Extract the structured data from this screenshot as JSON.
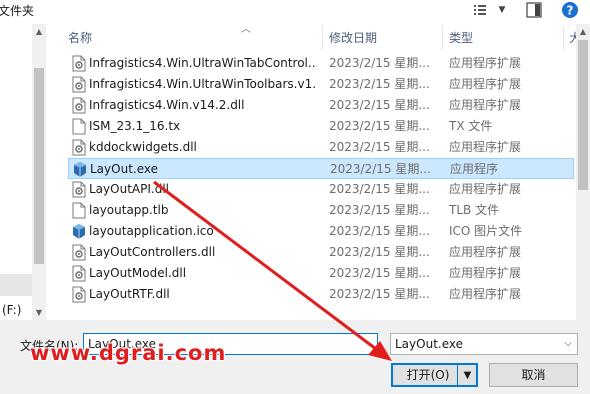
{
  "toolbar": {
    "breadcrumb": "文件夹"
  },
  "nav": {
    "drive_label": "(F:)"
  },
  "columns": {
    "name": "名称",
    "date": "修改日期",
    "type": "类型",
    "size": "大"
  },
  "files": [
    {
      "name": "Infragistics4.Win.UltraWinTabControl....",
      "date": "2023/2/15 星期...",
      "type": "应用程序扩展",
      "icon": "dll-gear-icon",
      "selected": false
    },
    {
      "name": "Infragistics4.Win.UltraWinToolbars.v1...",
      "date": "2023/2/15 星期...",
      "type": "应用程序扩展",
      "icon": "dll-gear-icon",
      "selected": false
    },
    {
      "name": "Infragistics4.Win.v14.2.dll",
      "date": "2023/2/15 星期...",
      "type": "应用程序扩展",
      "icon": "dll-gear-icon",
      "selected": false
    },
    {
      "name": "ISM_23.1_16.tx",
      "date": "2023/2/15 星期...",
      "type": "TX 文件",
      "icon": "blank-file-icon",
      "selected": false
    },
    {
      "name": "kddockwidgets.dll",
      "date": "2023/2/15 星期...",
      "type": "应用程序扩展",
      "icon": "dll-gear-icon",
      "selected": false
    },
    {
      "name": "LayOut.exe",
      "date": "2023/2/15 星期...",
      "type": "应用程序",
      "icon": "layout-app-icon",
      "selected": true
    },
    {
      "name": "LayOutAPI.dll",
      "date": "2023/2/15 星期...",
      "type": "应用程序扩展",
      "icon": "dll-gear-icon",
      "selected": false
    },
    {
      "name": "layoutapp.tlb",
      "date": "2023/2/15 星期...",
      "type": "TLB 文件",
      "icon": "blank-file-icon",
      "selected": false
    },
    {
      "name": "layoutapplication.ico",
      "date": "2023/2/15 星期...",
      "type": "ICO 图片文件",
      "icon": "layout-app-icon",
      "selected": false
    },
    {
      "name": "LayOutControllers.dll",
      "date": "2023/2/15 星期...",
      "type": "应用程序扩展",
      "icon": "dll-gear-icon",
      "selected": false
    },
    {
      "name": "LayOutModel.dll",
      "date": "2023/2/15 星期...",
      "type": "应用程序扩展",
      "icon": "dll-gear-icon",
      "selected": false
    },
    {
      "name": "LayOutRTF.dll",
      "date": "2023/2/15 星期...",
      "type": "应用程序扩展",
      "icon": "dll-gear-icon",
      "selected": false
    }
  ],
  "bottom": {
    "filename_label": "文件名(N):",
    "filename_value": "LayOut.exe",
    "filter_value": "LayOut.exe",
    "open_label": "打开(O)",
    "cancel_label": "取消"
  },
  "watermark": "www.dgrai.com",
  "colors": {
    "selection_bg": "#cce8ff",
    "accent": "#0078d7",
    "annotation_red": "#e01e1e"
  }
}
